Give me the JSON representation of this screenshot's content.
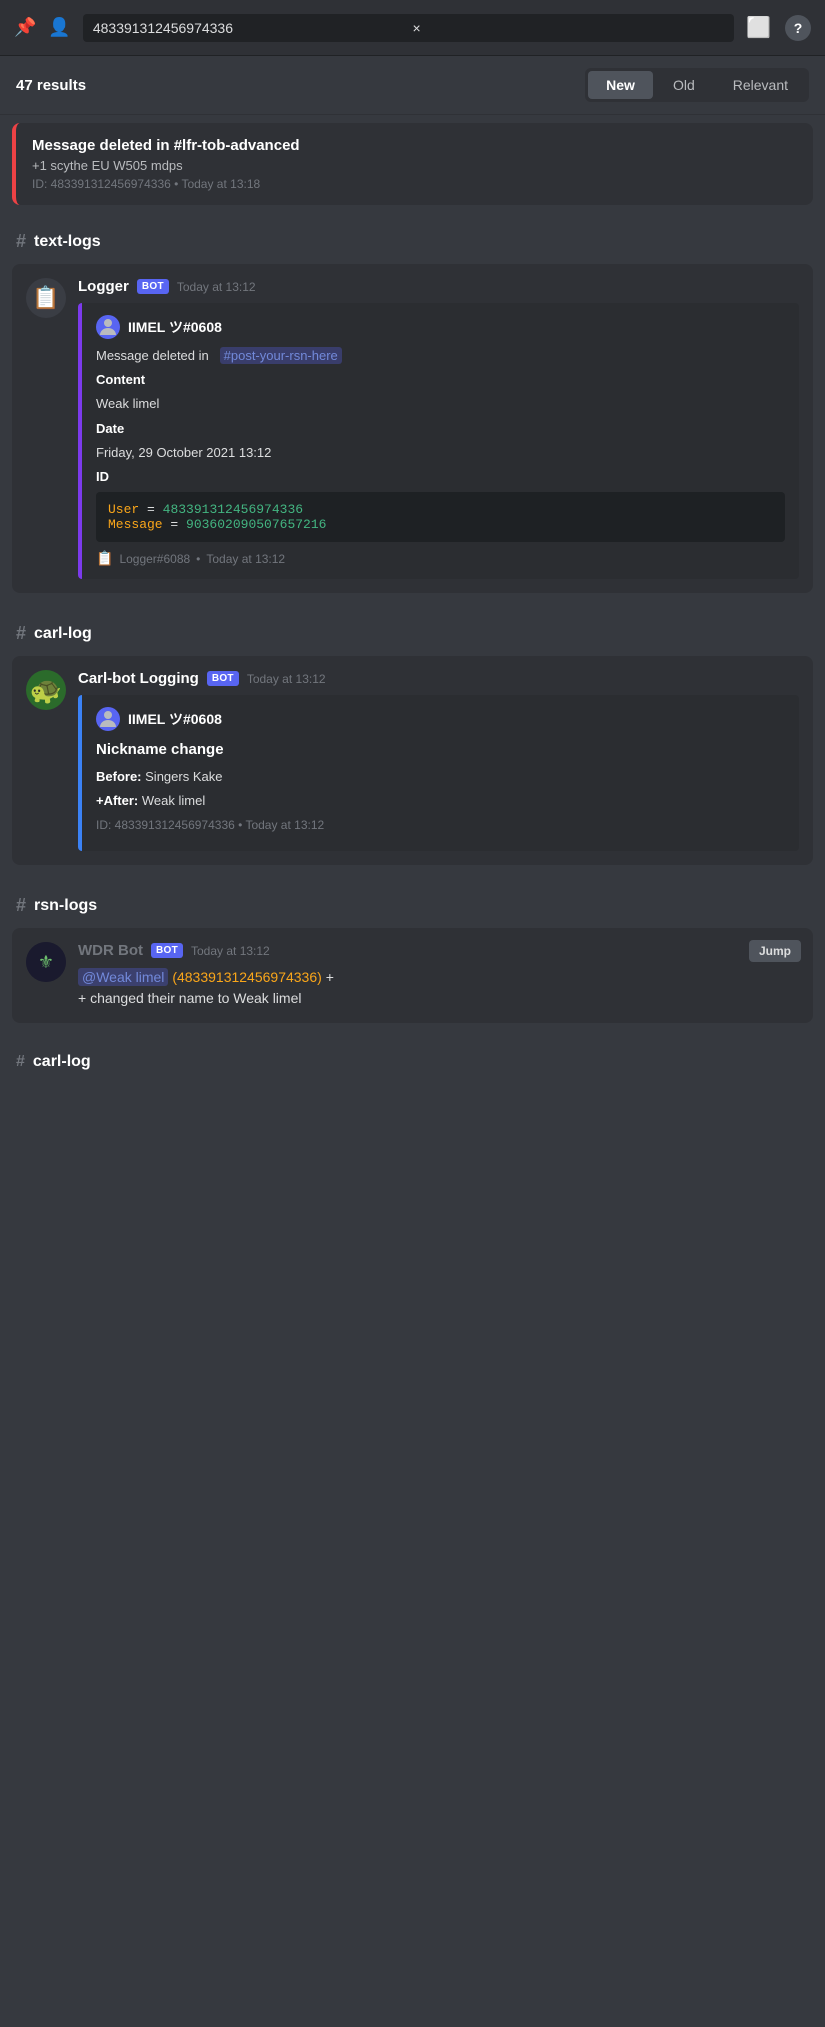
{
  "topbar": {
    "search_value": "483391312456974336",
    "clear_label": "×",
    "inbox_icon": "💬",
    "help_label": "?"
  },
  "results": {
    "count_label": "47 results",
    "filters": [
      {
        "id": "new",
        "label": "New",
        "active": true
      },
      {
        "id": "old",
        "label": "Old",
        "active": false
      },
      {
        "id": "relevant",
        "label": "Relevant",
        "active": false
      }
    ]
  },
  "deleted_top": {
    "title": "Message deleted in #lfr-tob-advanced",
    "desc": "+1 scythe EU W505 mdps",
    "meta": "ID: 483391312456974336 • Today at 13:18"
  },
  "section_text_logs": {
    "hash": "#",
    "label": "text-logs"
  },
  "logger_message": {
    "bot_name": "Logger",
    "bot_badge": "BOT",
    "timestamp": "Today at 13:12",
    "embed": {
      "user_avatar_emoji": "👤",
      "username": "IIMEL ツ#0608",
      "deleted_in_prefix": "Message deleted in",
      "channel": "#post-your-rsn-here",
      "content_label": "Content",
      "content_value": "Weak limel",
      "date_label": "Date",
      "date_value": "Friday, 29 October 2021 13:12",
      "id_label": "ID",
      "code_user_key": "User",
      "code_user_val": "483391312456974336",
      "code_message_key": "Message",
      "code_message_val": "903602090507657216"
    },
    "footer_icon": "📋",
    "footer_text": "Logger#6088",
    "footer_timestamp": "Today at 13:12"
  },
  "section_carl_log": {
    "hash": "#",
    "label": "carl-log"
  },
  "carlbot_message": {
    "bot_name": "Carl-bot Logging",
    "bot_badge": "BOT",
    "timestamp": "Today at 13:12",
    "embed": {
      "user_avatar_emoji": "👤",
      "username": "IIMEL ツ#0608",
      "title": "Nickname change",
      "before_label": "Before:",
      "before_value": "Singers Kake",
      "after_label": "+After:",
      "after_value": "Weak limel",
      "meta": "ID: 483391312456974336 • Today at 13:12"
    }
  },
  "section_rsn_logs": {
    "hash": "#",
    "label": "rsn-logs"
  },
  "wdr_message": {
    "bot_name": "WDR Bot",
    "bot_badge": "BOT",
    "timestamp": "Today at 13:12",
    "jump_label": "Jump",
    "mention": "@Weak limel",
    "id_ref": "(483391312456974336)",
    "suffix": "+ changed their name to Weak limel"
  },
  "section_carl_log2": {
    "hash": "#",
    "label": "carl-log"
  }
}
